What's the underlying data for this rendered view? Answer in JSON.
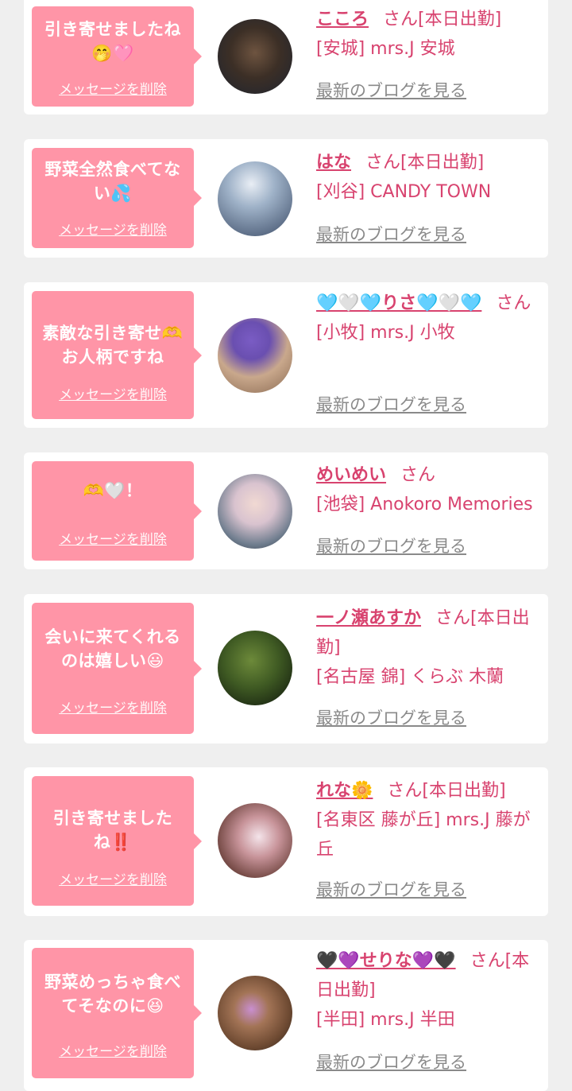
{
  "colors": {
    "background": "#efefef",
    "card": "#ffffff",
    "bubble": "#ff95a7",
    "accent": "#d8436f",
    "link_gray": "#8a8a8a"
  },
  "messages": [
    {
      "message": "引き寄せましたね🤭🩷",
      "delete_label": "メッセージを削除",
      "name": "こころ",
      "suffix": "さん[本日出勤]",
      "shop": "[安城] mrs.J 安城",
      "blog_label": "最新のブログを見る"
    },
    {
      "message": "野菜全然食べてない💦",
      "delete_label": "メッセージを削除",
      "name": "はな",
      "suffix": "さん[本日出勤]",
      "shop": "[刈谷] CANDY TOWN",
      "blog_label": "最新のブログを見る"
    },
    {
      "message": "素敵な引き寄せ🫶お人柄ですね",
      "delete_label": "メッセージを削除",
      "name": "🩵🤍🩵りさ🩵🤍🩵",
      "suffix": "さん",
      "shop": "[小牧] mrs.J 小牧",
      "blog_label": "最新のブログを見る"
    },
    {
      "message": "🫶🤍！",
      "delete_label": "メッセージを削除",
      "name": "めいめい",
      "suffix": "さん",
      "shop": "[池袋] Anokoro Memories",
      "blog_label": "最新のブログを見る"
    },
    {
      "message": "会いに来てくれるのは嬉しい😃",
      "delete_label": "メッセージを削除",
      "name": "一ノ瀬あすか",
      "suffix": "さん[本日出勤]",
      "shop": "[名古屋 錦] くらぶ 木蘭",
      "blog_label": "最新のブログを見る"
    },
    {
      "message": "引き寄せましたね‼️",
      "delete_label": "メッセージを削除",
      "name": "れな🌼",
      "suffix": "さん[本日出勤]",
      "shop": "[名東区 藤が丘] mrs.J 藤が丘",
      "blog_label": "最新のブログを見る"
    },
    {
      "message": "野菜めっちゃ食べてそなのに😆",
      "delete_label": "メッセージを削除",
      "name": "🖤💜せりな💜🖤",
      "suffix": "さん[本日出勤]",
      "shop": "[半田] mrs.J 半田",
      "blog_label": "最新のブログを見る"
    }
  ]
}
